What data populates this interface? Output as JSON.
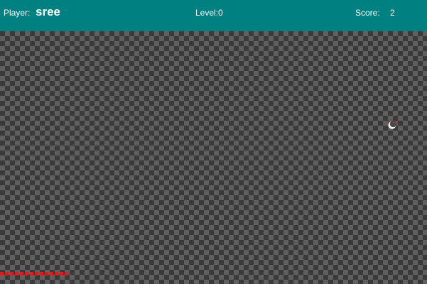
{
  "hud": {
    "player_label": "Player:",
    "player_name": "sree",
    "level_label": "Level:0",
    "score_label": "Score:",
    "score_value": "2",
    "background_color": "#008080",
    "text_color": "#ffffff"
  },
  "board": {
    "pattern": "checkerboard",
    "tile_colors": [
      "#3a3a3a",
      "#5f5f5f"
    ]
  },
  "snake": {
    "segment_count": 14,
    "color": "#e8171c"
  },
  "food": {
    "icon": "crescent-food-icon",
    "color": "#ffffff",
    "accent": "#e8171c"
  }
}
